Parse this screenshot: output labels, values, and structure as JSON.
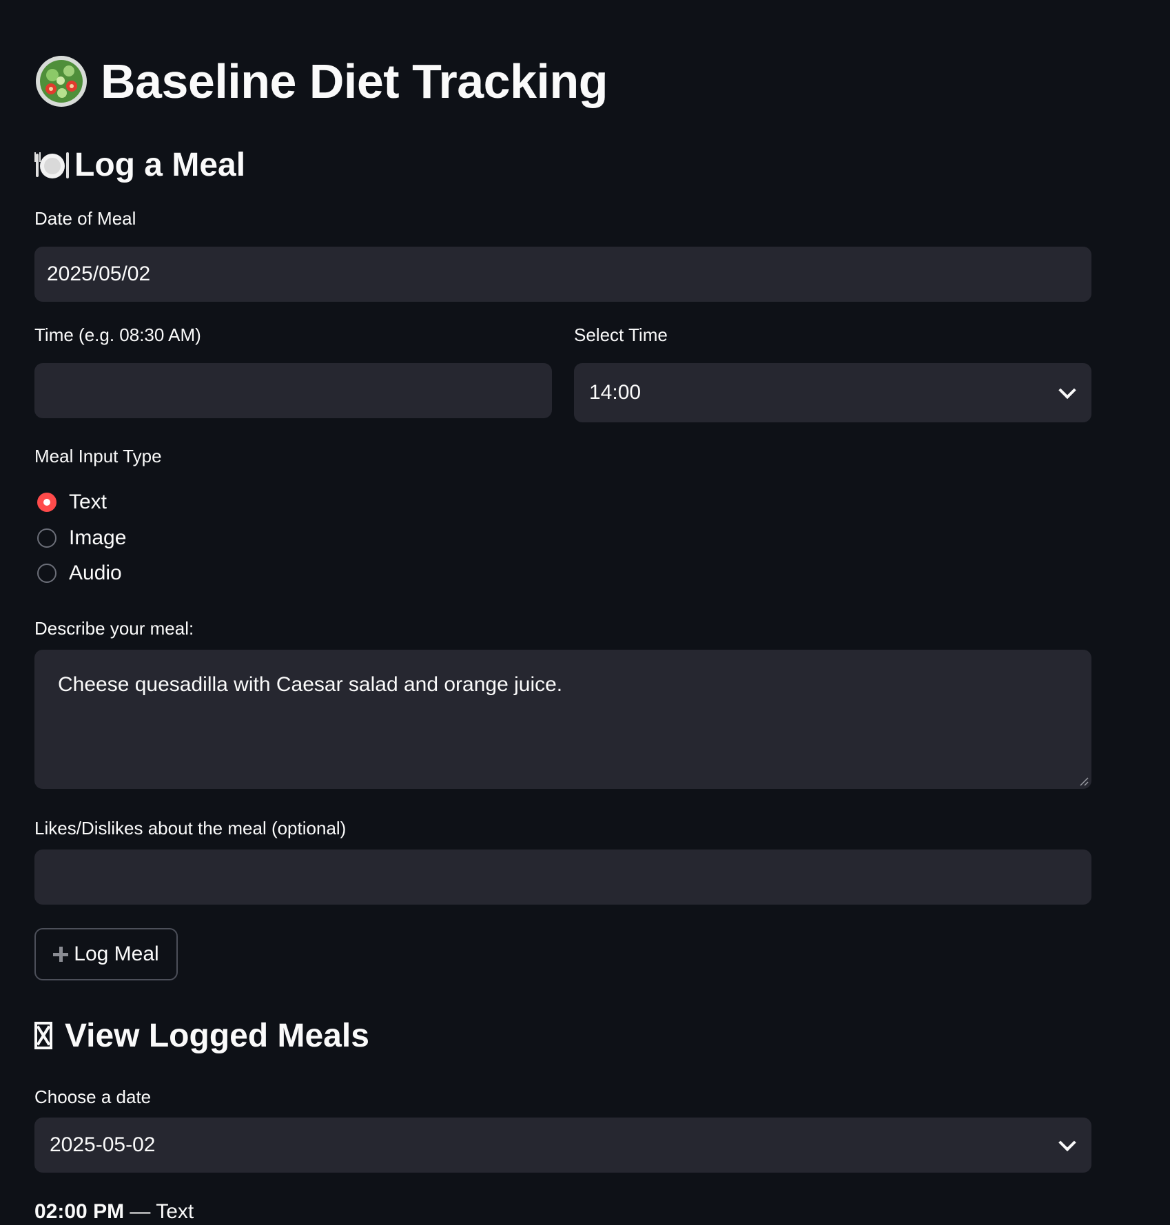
{
  "app": {
    "title": "Baseline Diet Tracking"
  },
  "log_section": {
    "heading": "Log a Meal",
    "date_label": "Date of Meal",
    "date_value": "2025/05/02",
    "time_label": "Time (e.g. 08:30 AM)",
    "time_value": "",
    "select_time_label": "Select Time",
    "select_time_value": "14:00",
    "input_type_label": "Meal Input Type",
    "input_types": [
      {
        "label": "Text",
        "checked": true
      },
      {
        "label": "Image",
        "checked": false
      },
      {
        "label": "Audio",
        "checked": false
      }
    ],
    "describe_label": "Describe your meal:",
    "describe_value": "Cheese quesadilla with Caesar salad and orange juice.",
    "likes_label": "Likes/Dislikes about the meal (optional)",
    "likes_value": "",
    "log_button": "Log Meal"
  },
  "view_section": {
    "heading": "View Logged Meals",
    "choose_date_label": "Choose a date",
    "choose_date_value": "2025-05-02",
    "entry_time": "02:00 PM",
    "entry_separator": " — ",
    "entry_type": "Text"
  },
  "colors": {
    "background": "#0e1117",
    "field": "#262730",
    "accent": "#ff4b4b",
    "text": "#fafafa"
  },
  "icons": {
    "title_icon": "green-salad-icon",
    "log_icon": "plate-with-cutlery-icon",
    "view_icon": "missing-glyph-icon",
    "button_icon": "plus-icon"
  }
}
